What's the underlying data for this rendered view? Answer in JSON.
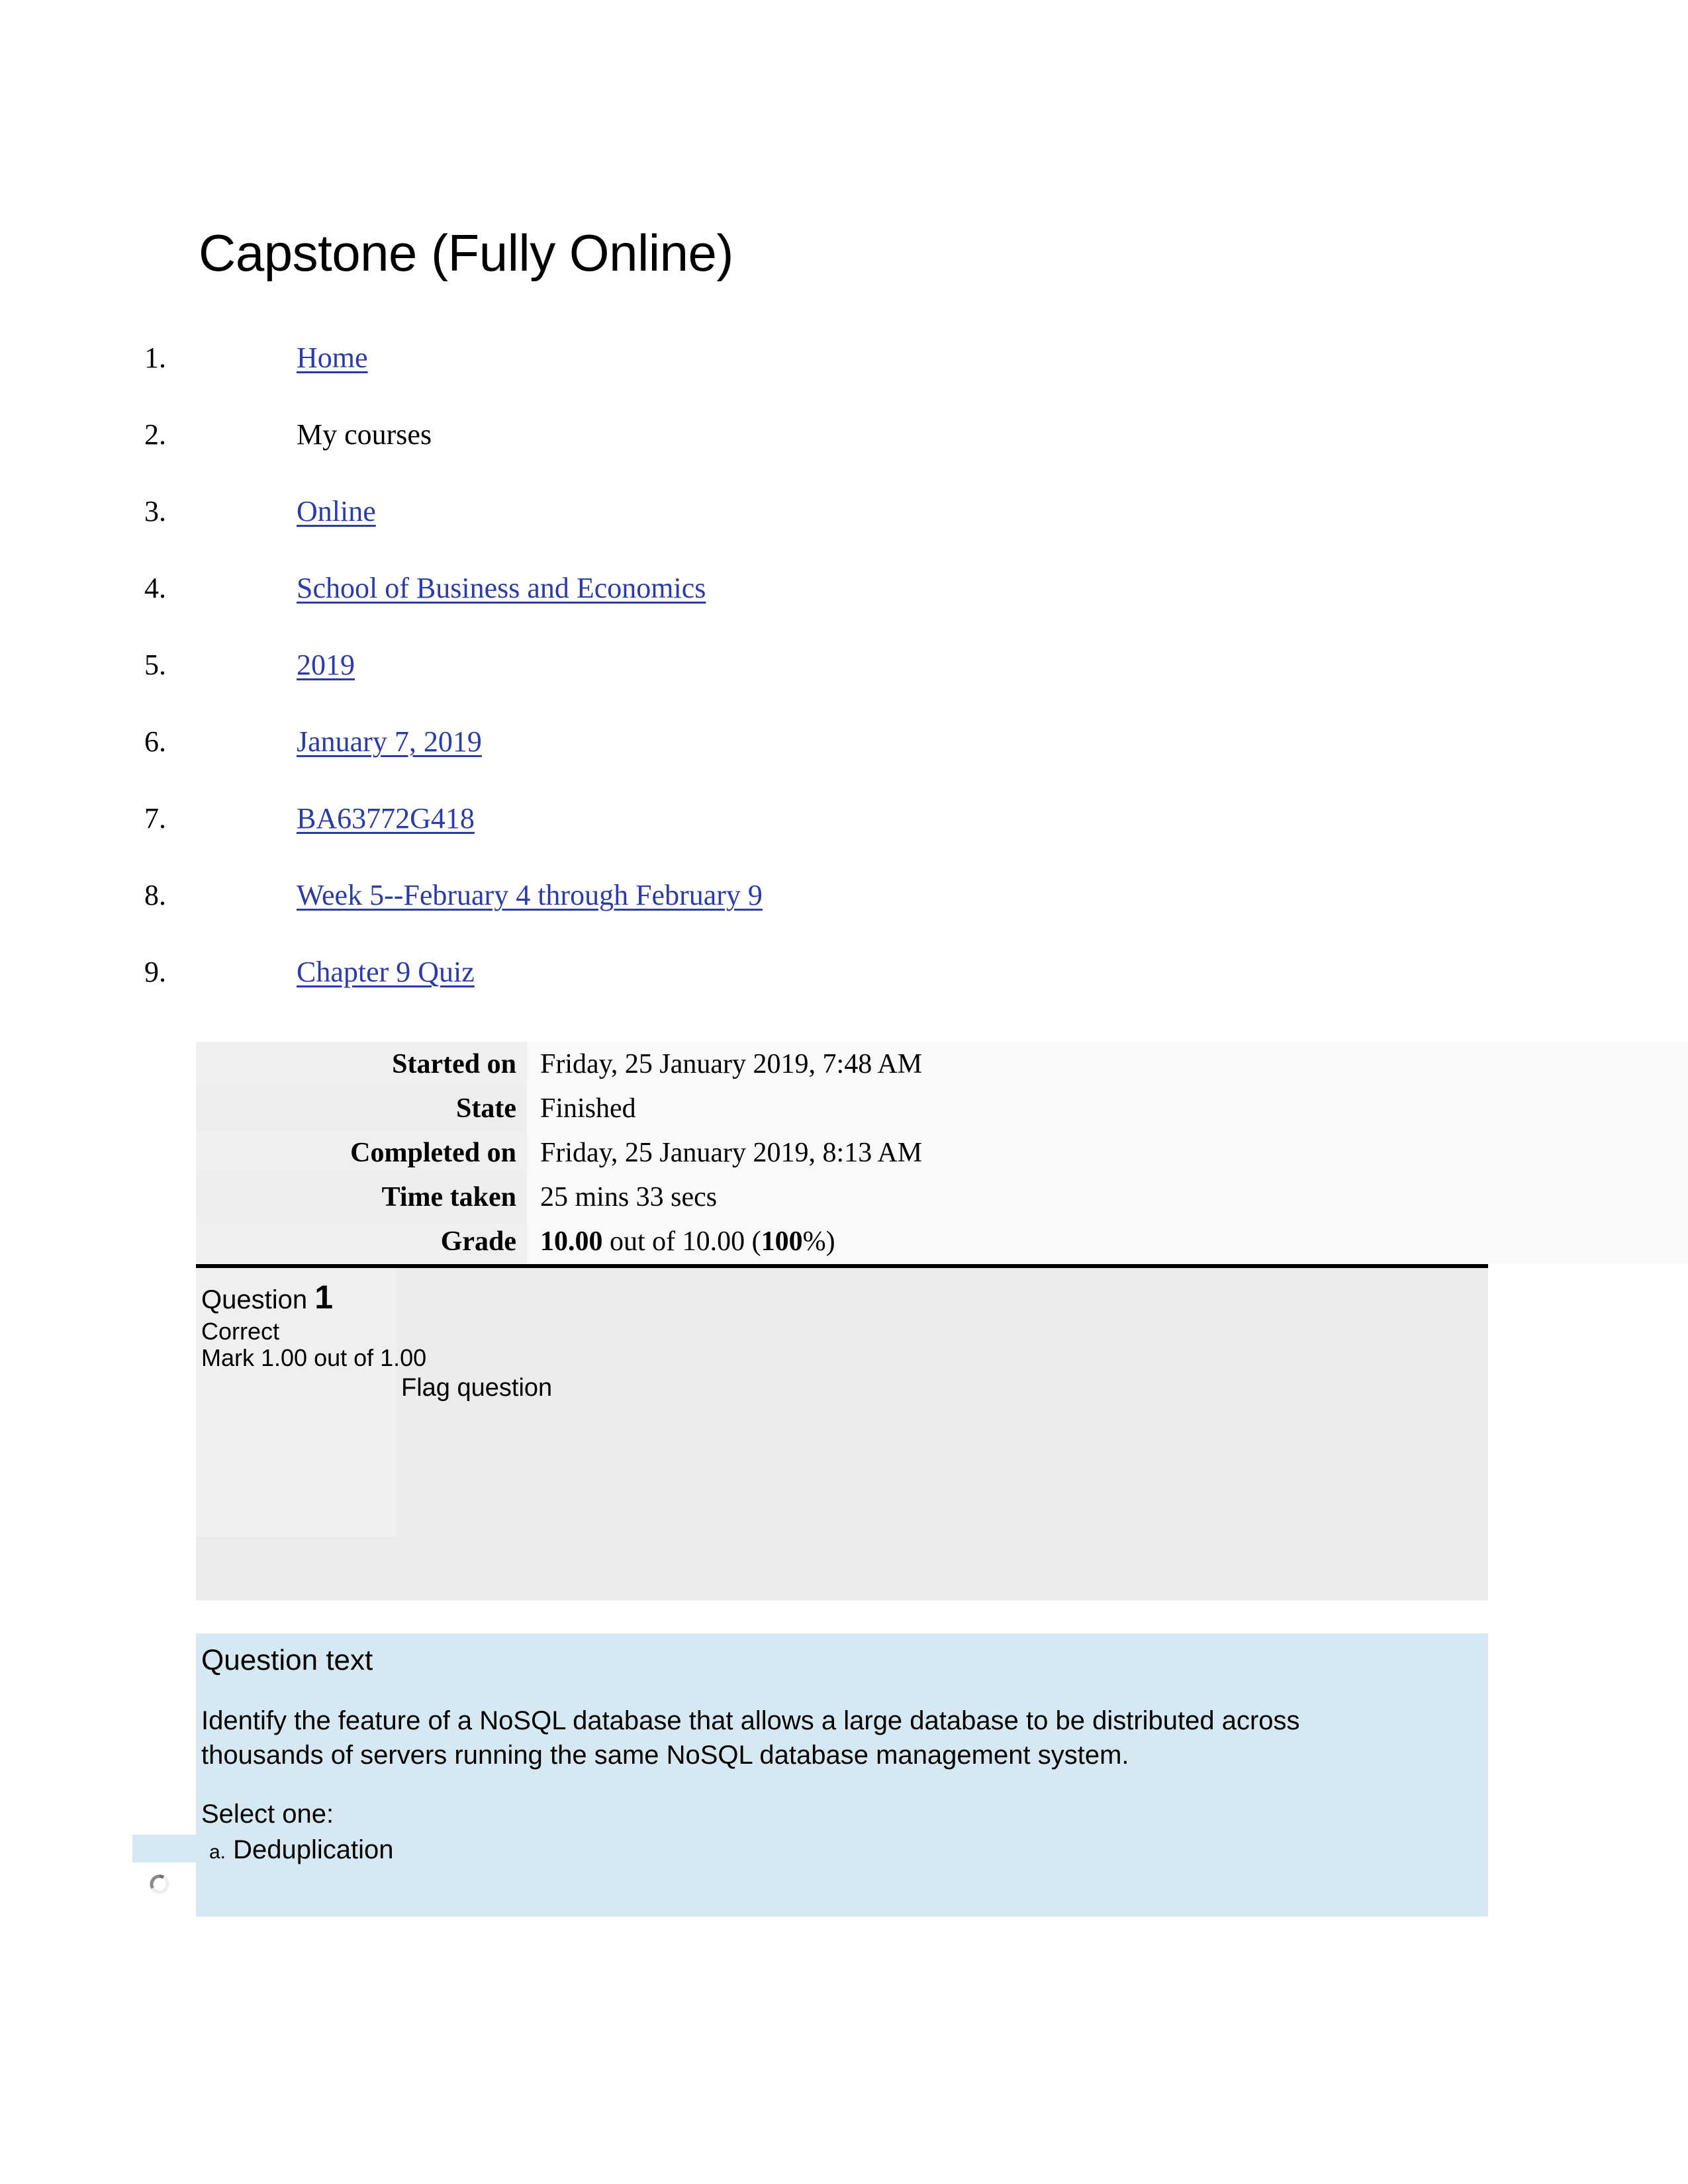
{
  "page": {
    "title": "Capstone (Fully Online)"
  },
  "breadcrumb": {
    "items": [
      {
        "number": "1.",
        "label": "Home",
        "is_link": true
      },
      {
        "number": "2.",
        "label": "My courses",
        "is_link": false
      },
      {
        "number": "3.",
        "label": "Online",
        "is_link": true
      },
      {
        "number": "4.",
        "label": "School of Business and Economics",
        "is_link": true
      },
      {
        "number": "5.",
        "label": "2019",
        "is_link": true
      },
      {
        "number": "6.",
        "label": "January 7, 2019",
        "is_link": true
      },
      {
        "number": "7.",
        "label": "BA63772G418",
        "is_link": true
      },
      {
        "number": "8.",
        "label": "Week 5--February 4 through February 9",
        "is_link": true
      },
      {
        "number": "9.",
        "label": "Chapter 9 Quiz",
        "is_link": true
      }
    ],
    "link_color": "#2b3ba7"
  },
  "attempt_summary": {
    "rows": [
      {
        "label": "Started on",
        "value": "Friday, 25 January 2019, 7:48 AM"
      },
      {
        "label": "State",
        "value": "Finished"
      },
      {
        "label": "Completed on",
        "value": "Friday, 25 January 2019, 8:13 AM"
      },
      {
        "label": "Time taken",
        "value": "25 mins 33 secs"
      }
    ],
    "grade": {
      "label": "Grade",
      "score": "10.00",
      "middle": " out of 10.00 (",
      "percent": "100",
      "suffix": "%)"
    },
    "label_bg": "#efefef",
    "value_bg": "#f9f9f9"
  },
  "question": {
    "heading_prefix": "Question",
    "number": "1",
    "state": "Correct",
    "mark": "Mark 1.00 out of 1.00",
    "flag_label": "Flag question",
    "panel_bg": "#e9ebec",
    "text_title": "Question text",
    "text_body": "Identify the feature of a NoSQL database that allows a large database to be distributed across thousands of servers running the same NoSQL database management system.",
    "select_prompt": "Select one:",
    "options": [
      {
        "letter": "a.",
        "label": "Deduplication"
      }
    ],
    "text_bg": "#d6e9f2"
  }
}
